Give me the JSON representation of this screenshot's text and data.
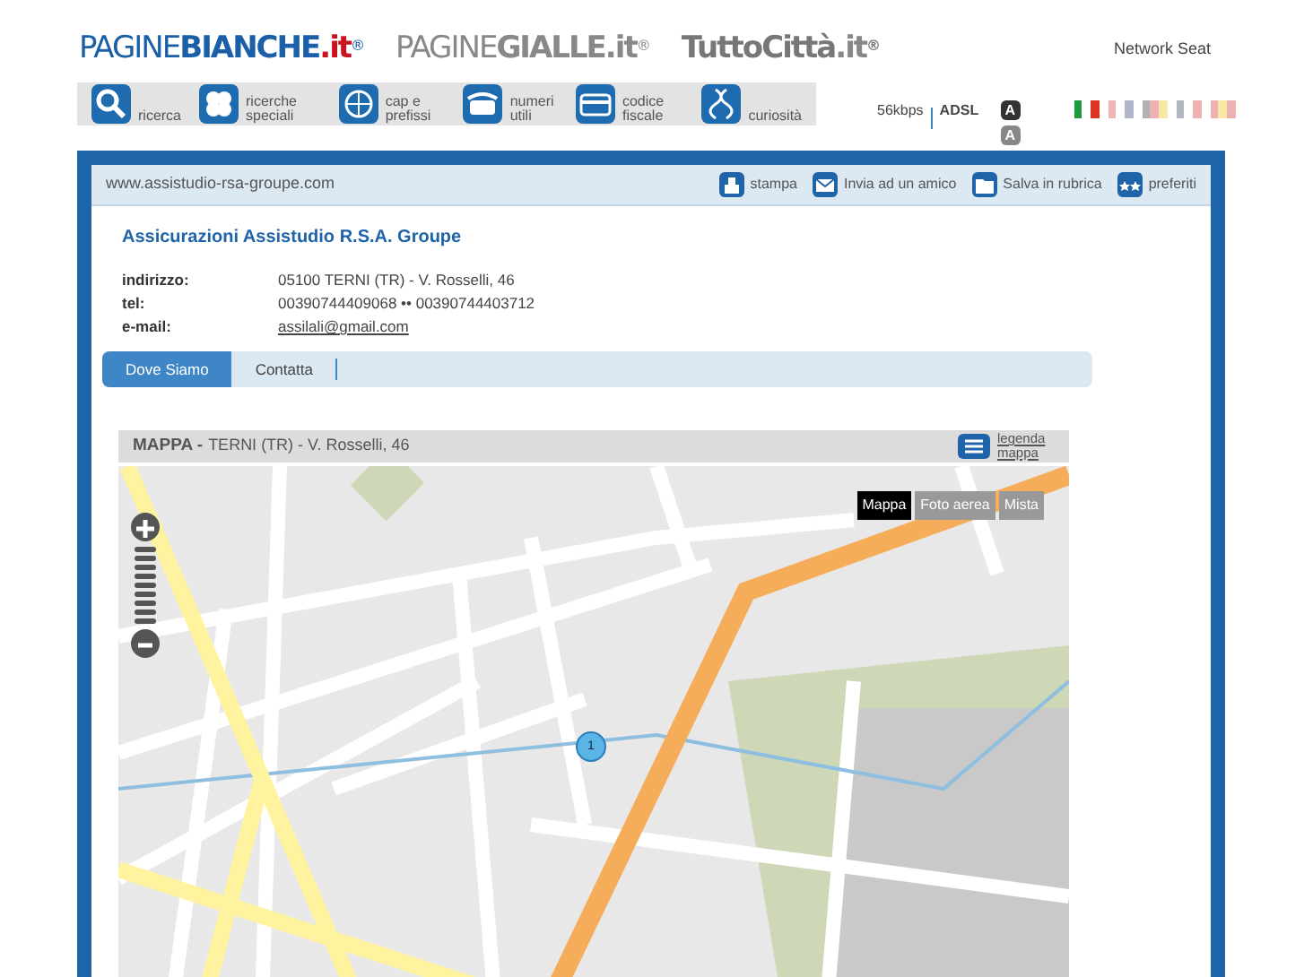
{
  "header": {
    "logos": [
      {
        "kind": "bianche",
        "light": "PAGINE",
        "bold": "BIANCHE",
        "suffix": ".it",
        "mark": "®"
      },
      {
        "kind": "gialle",
        "light": "PAGINE",
        "bold": "GIALLE",
        "suffix": ".it",
        "mark": "®"
      },
      {
        "kind": "tutto",
        "bold": "TuttoCittà",
        "suffix": ".it",
        "mark": "®"
      }
    ],
    "network": "Network Seat"
  },
  "nav": {
    "items": [
      {
        "label": "ricerca"
      },
      {
        "label": "ricerche speciali"
      },
      {
        "label": "cap e prefissi"
      },
      {
        "label": "numeri utili"
      },
      {
        "label": "codice fiscale"
      },
      {
        "label": "curiosità"
      }
    ],
    "speed": [
      {
        "label": "56kbps",
        "selected": false
      },
      {
        "label": "ADSL",
        "selected": true
      }
    ],
    "font_sizes": [
      "A",
      "A"
    ],
    "languages": [
      {
        "selected": true
      },
      {
        "selected": false
      },
      {
        "selected": false
      },
      {
        "selected": false
      },
      {
        "selected": false
      }
    ]
  },
  "toolbar": {
    "url": "www.assistudio-rsa-groupe.com",
    "actions": [
      {
        "label": "stampa"
      },
      {
        "label": "Invia ad un amico"
      },
      {
        "label": "Salva in rubrica"
      },
      {
        "label": "preferiti"
      }
    ]
  },
  "company": {
    "name": "Assicurazioni Assistudio R.S.A. Groupe",
    "fields": [
      {
        "label": "indirizzo:",
        "value": "05100 TERNI (TR) - V. Rosselli, 46",
        "kind": "text"
      },
      {
        "label": "tel:",
        "value": "00390744409068 •• 00390744403712",
        "kind": "text"
      },
      {
        "label": "e-mail:",
        "value": "assilali@gmail.com",
        "kind": "link"
      }
    ]
  },
  "tabs": [
    {
      "label": "Dove Siamo",
      "selected": true
    },
    {
      "label": "Contatta",
      "selected": false
    }
  ],
  "map": {
    "title": "MAPPA -",
    "address": "TERNI (TR) - V. Rosselli, 46",
    "legend": "legenda mappa",
    "modes": [
      {
        "label": "Mappa",
        "selected": true
      },
      {
        "label": "Foto aerea",
        "selected": false
      },
      {
        "label": "Mista",
        "selected": false
      }
    ],
    "marker": "1"
  }
}
